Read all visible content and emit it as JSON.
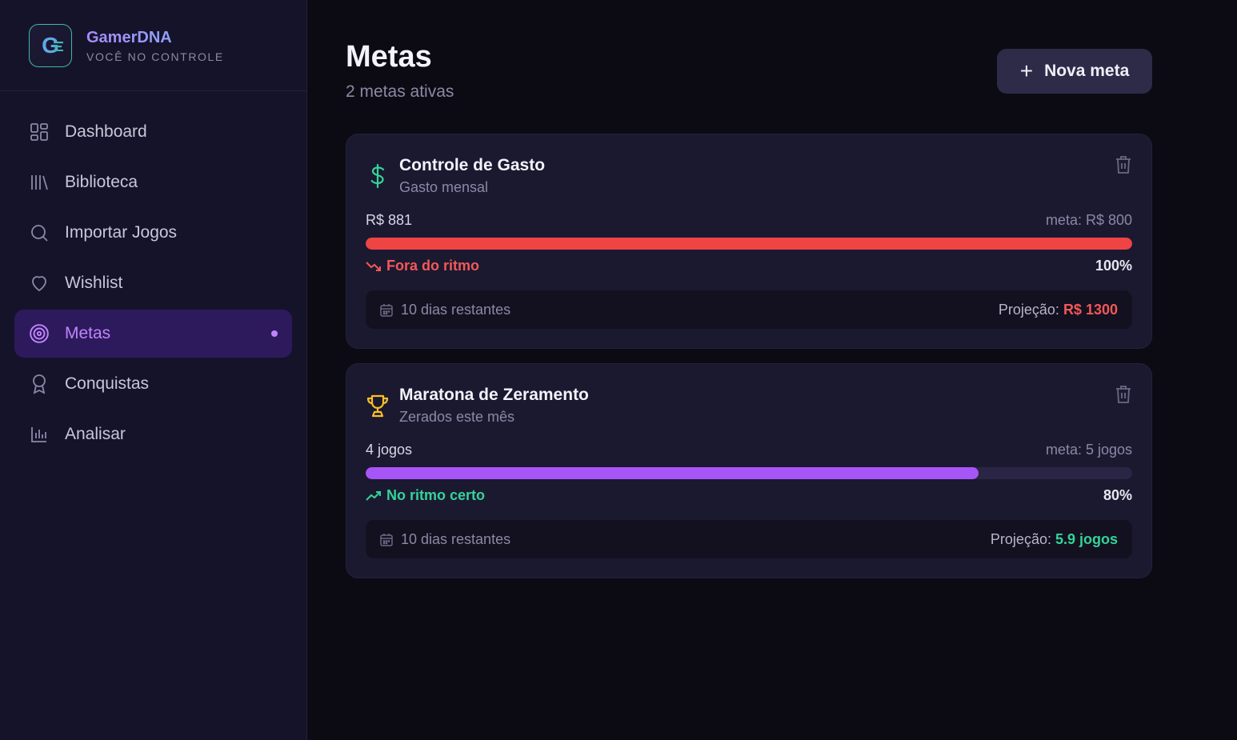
{
  "brand": {
    "name": "GamerDNA",
    "tagline": "VOCÊ NO CONTROLE",
    "logo_letter": "G"
  },
  "nav": [
    {
      "label": "Dashboard",
      "icon": "dashboard-icon",
      "active": false
    },
    {
      "label": "Biblioteca",
      "icon": "library-icon",
      "active": false
    },
    {
      "label": "Importar Jogos",
      "icon": "search-icon",
      "active": false
    },
    {
      "label": "Wishlist",
      "icon": "heart-icon",
      "active": false
    },
    {
      "label": "Metas",
      "icon": "target-icon",
      "active": true
    },
    {
      "label": "Conquistas",
      "icon": "award-icon",
      "active": false
    },
    {
      "label": "Analisar",
      "icon": "bar-chart-icon",
      "active": false
    }
  ],
  "header": {
    "title": "Metas",
    "subtitle": "2 metas ativas",
    "new_button": "Nova meta"
  },
  "goals": [
    {
      "title": "Controle de Gasto",
      "subtitle": "Gasto mensal",
      "icon": "dollar-icon",
      "current": "R$ 881",
      "goal": "meta: R$ 800",
      "progress": 1.0,
      "percent": "100%",
      "status": "Fora do ritmo",
      "status_color": "#f25858",
      "bar_color": "#ef4444",
      "days_left": "10 dias restantes",
      "projection_label": "Projeção: ",
      "projection_value": "R$ 1300",
      "projection_color": "#f25858"
    },
    {
      "title": "Maratona de Zeramento",
      "subtitle": "Zerados este mês",
      "icon": "trophy-icon",
      "current": "4 jogos",
      "goal": "meta: 5 jogos",
      "progress": 0.8,
      "percent": "80%",
      "status": "No ritmo certo",
      "status_color": "#34d399",
      "bar_color": "#a855f7",
      "days_left": "10 dias restantes",
      "projection_label": "Projeção: ",
      "projection_value": "5.9 jogos",
      "projection_color": "#34d399"
    }
  ]
}
